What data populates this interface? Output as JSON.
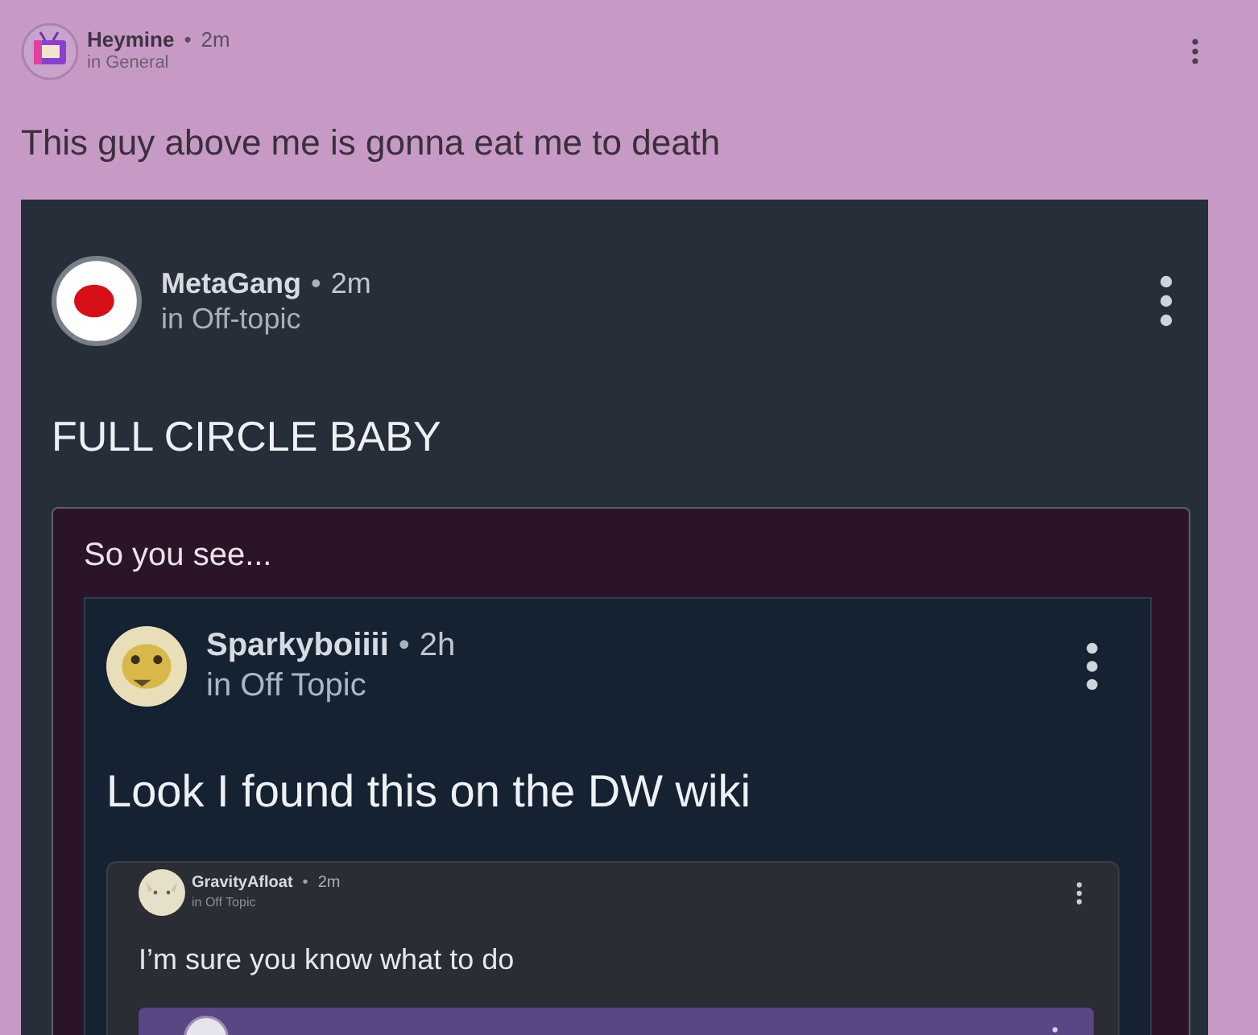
{
  "post": {
    "kind": "post",
    "author": "Heymine",
    "dot": "•",
    "time": "2m",
    "channel": "in General",
    "text": "This guy above me is gonna eat me to death",
    "embed": {
      "kind": "post",
      "author": "MetaGang",
      "dot": "•",
      "time": "2m",
      "channel": "in Off-topic",
      "text": "FULL CIRCLE BABY",
      "embed": {
        "kind": "quote",
        "text": "So you see...",
        "embed": {
          "kind": "post",
          "author": "Sparkyboiiii",
          "dot": "•",
          "time": "2h",
          "channel": "in Off Topic",
          "text": "Look I found this on the DW wiki",
          "embed": {
            "kind": "post",
            "author": "GravityAfloat",
            "dot": "•",
            "time": "2m",
            "channel": "in Off Topic",
            "text": "I’m sure you know what to do",
            "embed": {
              "kind": "post"
            }
          }
        }
      }
    }
  }
}
